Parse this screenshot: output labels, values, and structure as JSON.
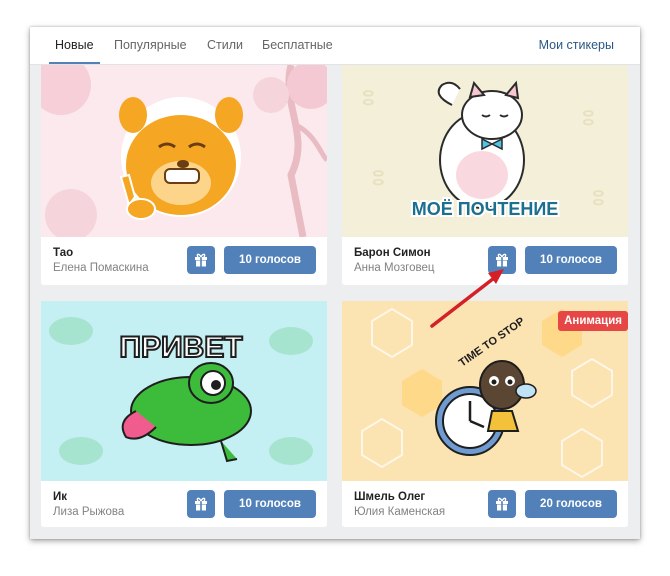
{
  "tabs": {
    "items": [
      {
        "label": "Новые",
        "active": true
      },
      {
        "label": "Популярные",
        "active": false
      },
      {
        "label": "Стили",
        "active": false
      },
      {
        "label": "Бесплатные",
        "active": false
      }
    ],
    "my_stickers": "Мои стикеры"
  },
  "cards": [
    {
      "name": "Тао",
      "author": "Елена Помаскина",
      "vote_label": "10 голосов"
    },
    {
      "name": "Барон Симон",
      "author": "Анна Мозговец",
      "vote_label": "10 голосов",
      "image_text": "МОЁ ПОЧТЕНИЕ"
    },
    {
      "name": "Ик",
      "author": "Лиза Рыжова",
      "vote_label": "10 голосов",
      "image_text": "ПРИВЕТ"
    },
    {
      "name": "Шмель Олег",
      "author": "Юлия Каменская",
      "vote_label": "20 голосов",
      "image_text": "TIME TO STOP",
      "badge": "Анимация"
    }
  ],
  "colors": {
    "accent": "#5181b8",
    "badge": "#e64646",
    "arrow": "#d42027"
  }
}
